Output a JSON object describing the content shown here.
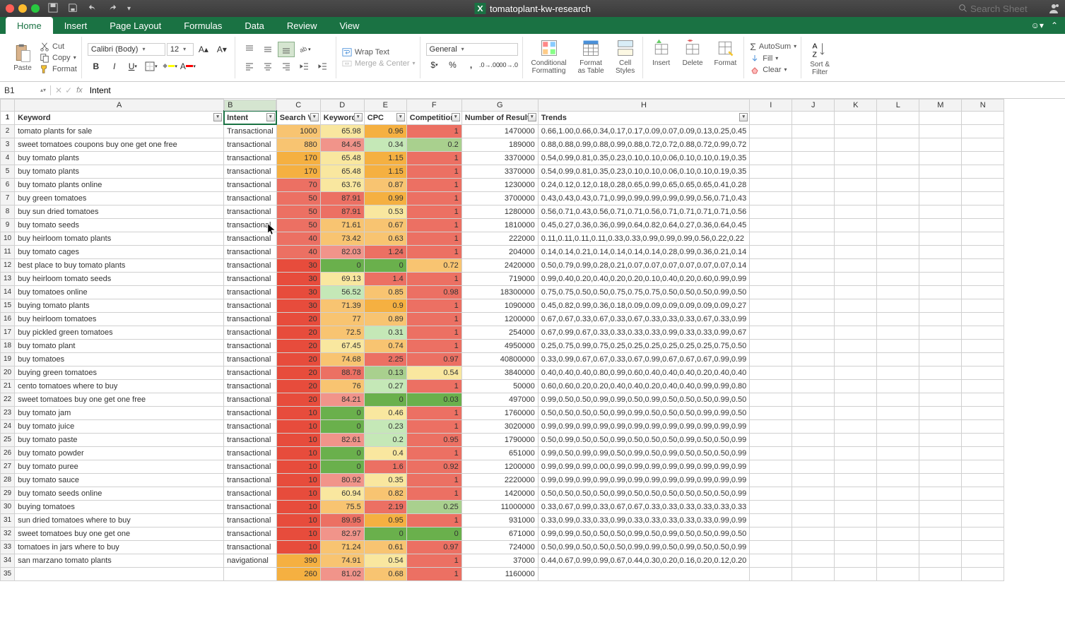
{
  "window": {
    "title": "tomatoplant-kw-research",
    "search_placeholder": "Search Sheet"
  },
  "ribbon": {
    "tabs": [
      "Home",
      "Insert",
      "Page Layout",
      "Formulas",
      "Data",
      "Review",
      "View"
    ],
    "active_tab": 0,
    "paste_label": "Paste",
    "cut_label": "Cut",
    "copy_label": "Copy",
    "format_label": "Format",
    "font_name": "Calibri (Body)",
    "font_size": "12",
    "wrap_label": "Wrap Text",
    "merge_label": "Merge & Center",
    "number_format": "General",
    "cond_fmt_label": "Conditional\nFormatting",
    "fmt_table_label": "Format\nas Table",
    "cell_styles_label": "Cell\nStyles",
    "insert_label": "Insert",
    "delete_label": "Delete",
    "format2_label": "Format",
    "autosum_label": "AutoSum",
    "fill_label": "Fill",
    "clear_label": "Clear",
    "sort_label": "Sort &\nFilter"
  },
  "formula_bar": {
    "cell_ref": "B1",
    "value": "Intent"
  },
  "columns": [
    "A",
    "B",
    "C",
    "D",
    "E",
    "F",
    "G",
    "H",
    "I",
    "J",
    "K",
    "L",
    "M",
    "N"
  ],
  "headers": [
    "Keyword",
    "Intent",
    "Search Vo",
    "Keyword",
    "CPC",
    "Competition",
    "Number of Results",
    "Trends"
  ],
  "rows": [
    {
      "n": 2,
      "kw": "tomato plants for sale",
      "intent": "Transactional",
      "sv": 1000,
      "kd": 65.98,
      "cpc": 0.96,
      "comp": 1,
      "res": 1470000,
      "trend": "0.66,1.00,0.66,0.34,0.17,0.17,0.09,0.07,0.09,0.13,0.25,0.45"
    },
    {
      "n": 3,
      "kw": "sweet tomatoes coupons buy one get one free",
      "intent": "transactional",
      "sv": 880,
      "kd": 84.45,
      "cpc": 0.34,
      "comp": 0.2,
      "res": 189000,
      "trend": "0.88,0.88,0.99,0.88,0.99,0.88,0.72,0.72,0.88,0.72,0.99,0.72"
    },
    {
      "n": 4,
      "kw": "buy tomato plants",
      "intent": "transactional",
      "sv": 170,
      "kd": 65.48,
      "cpc": 1.15,
      "comp": 1,
      "res": 3370000,
      "trend": "0.54,0.99,0.81,0.35,0.23,0.10,0.10,0.06,0.10,0.10,0.19,0.35"
    },
    {
      "n": 5,
      "kw": "buy tomato plants",
      "intent": "transactional",
      "sv": 170,
      "kd": 65.48,
      "cpc": 1.15,
      "comp": 1,
      "res": 3370000,
      "trend": "0.54,0.99,0.81,0.35,0.23,0.10,0.10,0.06,0.10,0.10,0.19,0.35"
    },
    {
      "n": 6,
      "kw": "buy tomato plants online",
      "intent": "transactional",
      "sv": 70,
      "kd": 63.76,
      "cpc": 0.87,
      "comp": 1,
      "res": 1230000,
      "trend": "0.24,0.12,0.12,0.18,0.28,0.65,0.99,0.65,0.65,0.65,0.41,0.28"
    },
    {
      "n": 7,
      "kw": "buy green tomatoes",
      "intent": "transactional",
      "sv": 50,
      "kd": 87.91,
      "cpc": 0.99,
      "comp": 1,
      "res": 3700000,
      "trend": "0.43,0.43,0.43,0.71,0.99,0.99,0.99,0.99,0.99,0.56,0.71,0.43"
    },
    {
      "n": 8,
      "kw": "buy sun dried tomatoes",
      "intent": "transactional",
      "sv": 50,
      "kd": 87.91,
      "cpc": 0.53,
      "comp": 1,
      "res": 1280000,
      "trend": "0.56,0.71,0.43,0.56,0.71,0.71,0.56,0.71,0.71,0.71,0.71,0.56"
    },
    {
      "n": 9,
      "kw": "buy tomato seeds",
      "intent": "transactional",
      "sv": 50,
      "kd": 71.61,
      "cpc": 0.67,
      "comp": 1,
      "res": 1810000,
      "trend": "0.45,0.27,0.36,0.36,0.99,0.64,0.82,0.64,0.27,0.36,0.64,0.45"
    },
    {
      "n": 10,
      "kw": "buy heirloom tomato plants",
      "intent": "transactional",
      "sv": 40,
      "kd": 73.42,
      "cpc": 0.63,
      "comp": 1,
      "res": 222000,
      "trend": "0.11,0.11,0.11,0.11,0.33,0.33,0.99,0.99,0.99,0.56,0.22,0.22"
    },
    {
      "n": 11,
      "kw": "buy tomato cages",
      "intent": "transactional",
      "sv": 40,
      "kd": 82.03,
      "cpc": 1.24,
      "comp": 1,
      "res": 204000,
      "trend": "0.14,0.14,0.21,0.14,0.14,0.14,0.14,0.28,0.99,0.36,0.21,0.14"
    },
    {
      "n": 12,
      "kw": "best place to buy tomato plants",
      "intent": "transactional",
      "sv": 30,
      "kd": 0,
      "cpc": 0,
      "comp": 0.72,
      "res": 2420000,
      "trend": "0.50,0.79,0.99,0.28,0.21,0.07,0.07,0.07,0.07,0.07,0.07,0.14"
    },
    {
      "n": 13,
      "kw": "buy heirloom tomato seeds",
      "intent": "transactional",
      "sv": 30,
      "kd": 69.13,
      "cpc": 1.4,
      "comp": 1,
      "res": 719000,
      "trend": "0.99,0.40,0.20,0.40,0.20,0.20,0.10,0.40,0.20,0.60,0.99,0.99"
    },
    {
      "n": 14,
      "kw": "buy tomatoes online",
      "intent": "transactional",
      "sv": 30,
      "kd": 56.52,
      "cpc": 0.85,
      "comp": 0.98,
      "res": 18300000,
      "trend": "0.75,0.75,0.50,0.50,0.75,0.75,0.75,0.50,0.50,0.50,0.99,0.50"
    },
    {
      "n": 15,
      "kw": "buying tomato plants",
      "intent": "transactional",
      "sv": 30,
      "kd": 71.39,
      "cpc": 0.9,
      "comp": 1,
      "res": 1090000,
      "trend": "0.45,0.82,0.99,0.36,0.18,0.09,0.09,0.09,0.09,0.09,0.09,0.27"
    },
    {
      "n": 16,
      "kw": "buy heirloom tomatoes",
      "intent": "transactional",
      "sv": 20,
      "kd": 77,
      "cpc": 0.89,
      "comp": 1,
      "res": 1200000,
      "trend": "0.67,0.67,0.33,0.67,0.33,0.67,0.33,0.33,0.33,0.67,0.33,0.99"
    },
    {
      "n": 17,
      "kw": "buy pickled green tomatoes",
      "intent": "transactional",
      "sv": 20,
      "kd": 72.5,
      "cpc": 0.31,
      "comp": 1,
      "res": 254000,
      "trend": "0.67,0.99,0.67,0.33,0.33,0.33,0.33,0.99,0.33,0.33,0.99,0.67"
    },
    {
      "n": 18,
      "kw": "buy tomato plant",
      "intent": "transactional",
      "sv": 20,
      "kd": 67.45,
      "cpc": 0.74,
      "comp": 1,
      "res": 4950000,
      "trend": "0.25,0.75,0.99,0.75,0.25,0.25,0.25,0.25,0.25,0.25,0.75,0.50"
    },
    {
      "n": 19,
      "kw": "buy tomatoes",
      "intent": "transactional",
      "sv": 20,
      "kd": 74.68,
      "cpc": 2.25,
      "comp": 0.97,
      "res": 40800000,
      "trend": "0.33,0.99,0.67,0.67,0.33,0.67,0.99,0.67,0.67,0.67,0.99,0.99"
    },
    {
      "n": 20,
      "kw": "buying green tomatoes",
      "intent": "transactional",
      "sv": 20,
      "kd": 88.78,
      "cpc": 0.13,
      "comp": 0.54,
      "res": 3840000,
      "trend": "0.40,0.40,0.40,0.80,0.99,0.60,0.40,0.40,0.40,0.20,0.40,0.40"
    },
    {
      "n": 21,
      "kw": "cento tomatoes where to buy",
      "intent": "transactional",
      "sv": 20,
      "kd": 76,
      "cpc": 0.27,
      "comp": 1,
      "res": 50000,
      "trend": "0.60,0.60,0.20,0.20,0.40,0.40,0.20,0.40,0.40,0.99,0.99,0.80"
    },
    {
      "n": 22,
      "kw": "sweet tomatoes buy one get one free",
      "intent": "transactional",
      "sv": 20,
      "kd": 84.21,
      "cpc": 0,
      "comp": 0.03,
      "res": 497000,
      "trend": "0.99,0.50,0.50,0.99,0.99,0.50,0.99,0.50,0.50,0.50,0.99,0.50"
    },
    {
      "n": 23,
      "kw": "buy tomato jam",
      "intent": "transactional",
      "sv": 10,
      "kd": 0,
      "cpc": 0.46,
      "comp": 1,
      "res": 1760000,
      "trend": "0.50,0.50,0.50,0.50,0.99,0.99,0.50,0.50,0.50,0.99,0.99,0.50"
    },
    {
      "n": 24,
      "kw": "buy tomato juice",
      "intent": "transactional",
      "sv": 10,
      "kd": 0,
      "cpc": 0.23,
      "comp": 1,
      "res": 3020000,
      "trend": "0.99,0.99,0.99,0.99,0.99,0.99,0.99,0.99,0.99,0.99,0.99,0.99"
    },
    {
      "n": 25,
      "kw": "buy tomato paste",
      "intent": "transactional",
      "sv": 10,
      "kd": 82.61,
      "cpc": 0.2,
      "comp": 0.95,
      "res": 1790000,
      "trend": "0.50,0.99,0.50,0.50,0.99,0.50,0.50,0.50,0.99,0.50,0.50,0.99"
    },
    {
      "n": 26,
      "kw": "buy tomato powder",
      "intent": "transactional",
      "sv": 10,
      "kd": 0,
      "cpc": 0.4,
      "comp": 1,
      "res": 651000,
      "trend": "0.99,0.50,0.99,0.99,0.50,0.99,0.50,0.99,0.50,0.50,0.50,0.99"
    },
    {
      "n": 27,
      "kw": "buy tomato puree",
      "intent": "transactional",
      "sv": 10,
      "kd": 0,
      "cpc": 1.6,
      "comp": 0.92,
      "res": 1200000,
      "trend": "0.99,0.99,0.99,0.00,0.99,0.99,0.99,0.99,0.99,0.99,0.99,0.99"
    },
    {
      "n": 28,
      "kw": "buy tomato sauce",
      "intent": "transactional",
      "sv": 10,
      "kd": 80.92,
      "cpc": 0.35,
      "comp": 1,
      "res": 2220000,
      "trend": "0.99,0.99,0.99,0.99,0.99,0.99,0.99,0.99,0.99,0.99,0.99,0.99"
    },
    {
      "n": 29,
      "kw": "buy tomato seeds online",
      "intent": "transactional",
      "sv": 10,
      "kd": 60.94,
      "cpc": 0.82,
      "comp": 1,
      "res": 1420000,
      "trend": "0.50,0.50,0.50,0.50,0.99,0.50,0.50,0.50,0.50,0.50,0.50,0.99"
    },
    {
      "n": 30,
      "kw": "buying tomatoes",
      "intent": "transactional",
      "sv": 10,
      "kd": 75.5,
      "cpc": 2.19,
      "comp": 0.25,
      "res": 11000000,
      "trend": "0.33,0.67,0.99,0.33,0.67,0.67,0.33,0.33,0.33,0.33,0.33,0.33"
    },
    {
      "n": 31,
      "kw": "sun dried tomatoes where to buy",
      "intent": "transactional",
      "sv": 10,
      "kd": 89.95,
      "cpc": 0.95,
      "comp": 1,
      "res": 931000,
      "trend": "0.33,0.99,0.33,0.33,0.99,0.33,0.33,0.33,0.33,0.33,0.99,0.99"
    },
    {
      "n": 32,
      "kw": "sweet tomatoes buy one get one",
      "intent": "transactional",
      "sv": 10,
      "kd": 82.97,
      "cpc": 0,
      "comp": 0,
      "res": 671000,
      "trend": "0.99,0.99,0.50,0.50,0.50,0.99,0.50,0.99,0.50,0.50,0.99,0.50"
    },
    {
      "n": 33,
      "kw": "tomatoes in jars where to buy",
      "intent": "transactional",
      "sv": 10,
      "kd": 71.24,
      "cpc": 0.61,
      "comp": 0.97,
      "res": 724000,
      "trend": "0.50,0.99,0.50,0.50,0.50,0.99,0.99,0.50,0.99,0.50,0.50,0.99"
    },
    {
      "n": 34,
      "kw": "san marzano tomato plants",
      "intent": "navigational",
      "sv": 390,
      "kd": 74.91,
      "cpc": 0.54,
      "comp": 1,
      "res": 37000,
      "trend": "0.44,0.67,0.99,0.99,0.67,0.44,0.30,0.20,0.16,0.20,0.12,0.20"
    },
    {
      "n": 35,
      "kw": "",
      "intent": "",
      "sv": 260,
      "kd": 81.02,
      "cpc": 0.68,
      "comp": 1,
      "res": 1160000,
      "trend": ""
    }
  ]
}
